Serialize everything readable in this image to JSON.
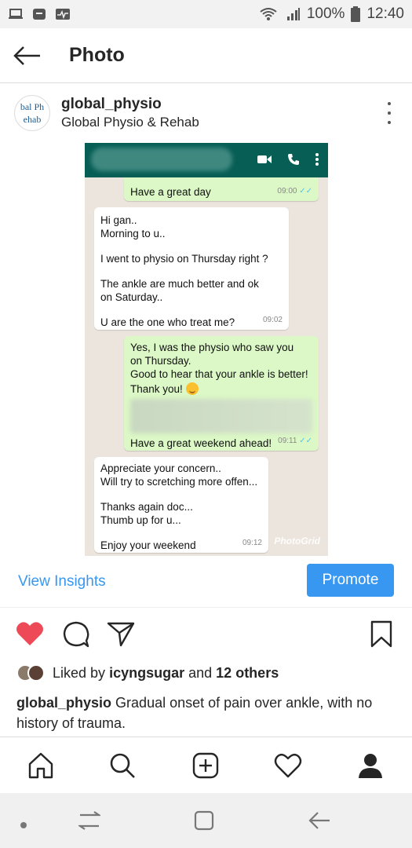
{
  "status_bar": {
    "battery": "100%",
    "time": "12:40"
  },
  "topbar": {
    "title": "Photo"
  },
  "post_header": {
    "username": "global_physio",
    "location": "Global Physio & Rehab",
    "avatar_text_1": "bal Ph",
    "avatar_text_2": "ehab"
  },
  "chat": {
    "msg1": {
      "text": "Have a great day",
      "time": "09:00"
    },
    "msg2": {
      "l1": "Hi gan..",
      "l2": "Morning  to u..",
      "l3": "I went to physio on Thursday right ?",
      "l4": "The ankle are much better and ok",
      "l5": "on Saturday..",
      "l6": "U are the one who treat me?",
      "time": "09:02"
    },
    "msg3": {
      "l1": "Yes, I was the physio who saw you",
      "l2": "on Thursday.",
      "l3": "Good to hear that your ankle is better!",
      "l4": "Thank you!",
      "l5": "Have a great weekend ahead!",
      "time": "09:11"
    },
    "msg4": {
      "l1": "Appreciate your concern..",
      "l2": "Will try to scretching more offen...",
      "l3": "Thanks again doc...",
      "l4": "Thumb up for u...",
      "l5": "Enjoy your weekend",
      "time": "09:12"
    },
    "watermark": "PhotoGrid"
  },
  "insights": {
    "view_label": "View Insights",
    "promote_label": "Promote"
  },
  "likes": {
    "prefix": "Liked by",
    "user": "icyngsugar",
    "and": "and",
    "others": "12 others"
  },
  "caption": {
    "username": "global_physio",
    "text": "Gradual onset of pain over ankle, with no history of trauma."
  },
  "colors": {
    "accent": "#3897f0",
    "heart": "#ed4956",
    "wa_green": "#075e54",
    "wa_out": "#dcf8c6"
  }
}
